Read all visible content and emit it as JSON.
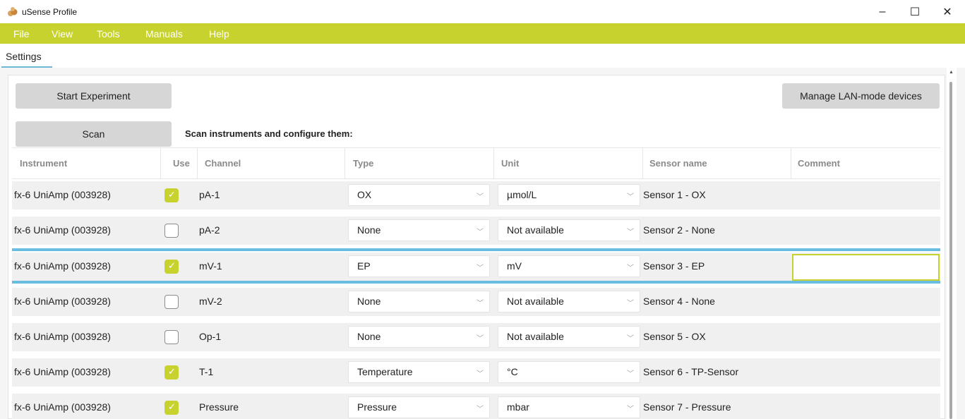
{
  "window": {
    "title": "uSense Profile",
    "controls": {
      "minimize": "–",
      "maximize": "☐",
      "close": "✕"
    }
  },
  "menu": [
    "File",
    "View",
    "Tools",
    "Manuals",
    "Help"
  ],
  "tabs": [
    "Settings"
  ],
  "buttons": {
    "start": "Start Experiment",
    "manage": "Manage LAN-mode devices",
    "scan": "Scan"
  },
  "scan_label": "Scan instruments and configure them:",
  "table": {
    "headers": [
      "Instrument",
      "Use",
      "Channel",
      "Type",
      "Unit",
      "Sensor name",
      "Comment"
    ],
    "rows": [
      {
        "instrument": "fx-6 UniAmp (003928)",
        "use": true,
        "channel": "pA-1",
        "type": "OX",
        "unit": "µmol/L",
        "sensor": "Sensor 1 - OX",
        "comment": ""
      },
      {
        "instrument": "fx-6 UniAmp (003928)",
        "use": false,
        "channel": "pA-2",
        "type": "None",
        "unit": "Not available",
        "sensor": "Sensor 2 - None",
        "comment": ""
      },
      {
        "instrument": "fx-6 UniAmp (003928)",
        "use": true,
        "channel": "mV-1",
        "type": "EP",
        "unit": "mV",
        "sensor": "Sensor 3 - EP",
        "comment": ""
      },
      {
        "instrument": "fx-6 UniAmp (003928)",
        "use": false,
        "channel": "mV-2",
        "type": "None",
        "unit": "Not available",
        "sensor": "Sensor 4 - None",
        "comment": ""
      },
      {
        "instrument": "fx-6 UniAmp (003928)",
        "use": false,
        "channel": "Op-1",
        "type": "None",
        "unit": "Not available",
        "sensor": "Sensor 5 - OX",
        "comment": ""
      },
      {
        "instrument": "fx-6 UniAmp (003928)",
        "use": true,
        "channel": "T-1",
        "type": "Temperature",
        "unit": "°C",
        "sensor": "Sensor 6 - TP-Sensor",
        "comment": ""
      },
      {
        "instrument": "fx-6 UniAmp (003928)",
        "use": true,
        "channel": "Pressure",
        "type": "Pressure",
        "unit": "mbar",
        "sensor": "Sensor 7 - Pressure",
        "comment": ""
      }
    ],
    "selected_row": 2
  },
  "colors": {
    "accent": "#c7d22e",
    "selection": "#69bde0",
    "row_bg": "#f0f0f0"
  }
}
